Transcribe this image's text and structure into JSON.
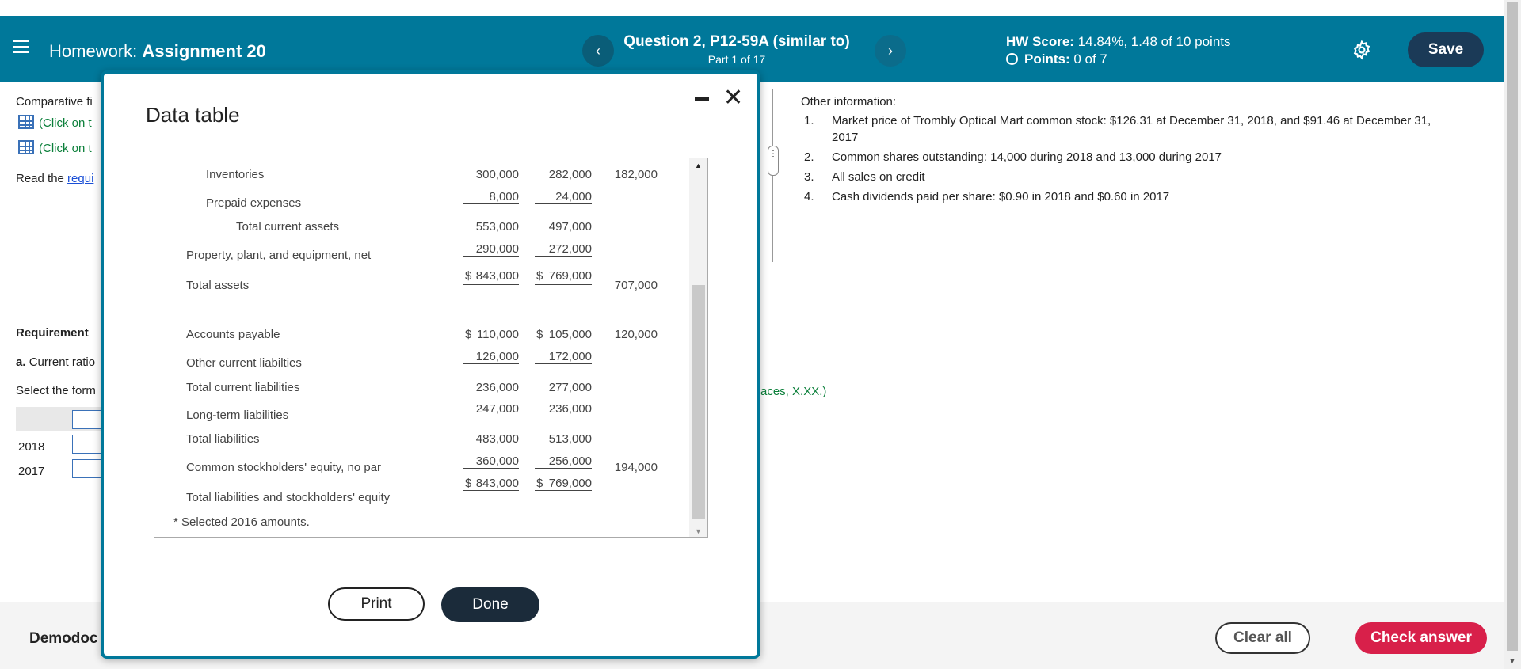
{
  "header": {
    "hw_label": "Homework:",
    "hw_name": "Assignment 20",
    "question_title": "Question 2, P12-59A (similar to)",
    "question_part": "Part 1 of 17",
    "prev_arrow": "‹",
    "next_arrow": "›",
    "score_label": "HW Score:",
    "score_value": "14.84%, 1.48 of 10 points",
    "points_label": "Points:",
    "points_value": "0 of 7",
    "save_label": "Save"
  },
  "background": {
    "comparative": "Comparative fi",
    "click1": "(Click on t",
    "click2": "(Click on t",
    "read_prefix": "Read the ",
    "read_link": "requi",
    "requirement": "Requirement",
    "current_ratio_a": "a.",
    "current_ratio": "Current ratio",
    "select_form": "Select the form",
    "year_2018": "2018",
    "year_2017": "2017",
    "hint_fragment": "aces, X.XX.)"
  },
  "other_info": {
    "title": "Other information:",
    "items": [
      {
        "num": "1.",
        "text": "Market price of Trombly Optical Mart common stock: $126.31 at December 31, 2018, and $91.46 at December 31,",
        "text2": "2017"
      },
      {
        "num": "2.",
        "text": "Common shares outstanding: 14,000 during 2018 and 13,000 during 2017"
      },
      {
        "num": "3.",
        "text": "All sales on credit"
      },
      {
        "num": "4.",
        "text": "Cash dividends paid per share: $0.90 in 2018 and $0.60 in 2017"
      }
    ]
  },
  "modal": {
    "title": "Data table",
    "rows": [
      {
        "label": "Inventories",
        "c1": "300,000",
        "c2": "282,000",
        "c3": "182,000"
      },
      {
        "label": "Prepaid expenses",
        "c1": "8,000",
        "c2": "24,000"
      },
      {
        "label": "Total current assets",
        "c1": "553,000",
        "c2": "497,000"
      },
      {
        "label": "Property, plant, and equipment, net",
        "c1": "290,000",
        "c2": "272,000"
      },
      {
        "label": "Total assets",
        "c1": "843,000",
        "c2": "769,000",
        "c3": "707,000"
      },
      {
        "label": "Accounts payable",
        "c1": "110,000",
        "c2": "105,000",
        "c3": "120,000"
      },
      {
        "label": "Other current liabilties",
        "c1": "126,000",
        "c2": "172,000"
      },
      {
        "label": "Total current liabilities",
        "c1": "236,000",
        "c2": "277,000"
      },
      {
        "label": "Long-term liabilities",
        "c1": "247,000",
        "c2": "236,000"
      },
      {
        "label": "Total liabilities",
        "c1": "483,000",
        "c2": "513,000"
      },
      {
        "label": "Common stockholders' equity, no par",
        "c1": "360,000",
        "c2": "256,000",
        "c3": "194,000"
      },
      {
        "label": "Total liabilities and stockholders' equity",
        "c1": "843,000",
        "c2": "769,000"
      }
    ],
    "currency": "$",
    "footnote": "* Selected 2016 amounts.",
    "print_label": "Print",
    "done_label": "Done"
  },
  "footer": {
    "brand": "Demodoc",
    "clear_label": "Clear all",
    "check_label": "Check answer"
  },
  "colors": {
    "header_bg": "#00789a",
    "save_bg": "#1b3a57",
    "check_bg": "#d8204a"
  }
}
